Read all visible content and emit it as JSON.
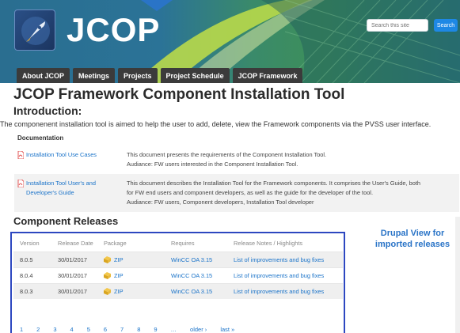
{
  "header": {
    "site_name": "JCOP",
    "search_placeholder": "Search this site",
    "search_button": "Search",
    "logo_icon": "rocket-icon"
  },
  "nav": {
    "tabs": [
      "About JCOP",
      "Meetings",
      "Projects",
      "Project Schedule",
      "JCOP Framework"
    ]
  },
  "page": {
    "title": "JCOP Framework Component Installation Tool",
    "intro_heading": "Introduction:",
    "intro_text": "The componenent installation tool is aimed to help the user to add, delete, view the Framework components via the PVSS user interface."
  },
  "documentation": {
    "heading": "Documentation",
    "rows": [
      {
        "link": "Installation Tool Use Cases",
        "desc_lines": [
          "This document presents the requirements of the Component Installation Tool.",
          "Audiance: FW users interested in the Component Installation Tool."
        ]
      },
      {
        "link": "Installation Tool User's and Developer's Guide",
        "desc_lines": [
          "This document describes the Installation Tool for the Framework components. It comprises the User's Guide, both",
          "for FW end users and component developers, as well as the guide for the developer of the tool.",
          "Audiance: FW users, Component developers, Installation Tool developer"
        ]
      }
    ]
  },
  "releases": {
    "heading": "Component Releases",
    "columns": {
      "version": "Version",
      "release_date": "Release Date",
      "package": "Package",
      "requires": "Requires",
      "notes": "Release Notes / Highlights"
    },
    "rows": [
      {
        "version": "8.0.5",
        "date": "30/01/2017",
        "package": "ZIP",
        "requires": "WinCC OA 3.15",
        "notes": "List of improvements and bug fixes"
      },
      {
        "version": "8.0.4",
        "date": "30/01/2017",
        "package": "ZIP",
        "requires": "WinCC OA 3.15",
        "notes": "List of improvements and bug fixes"
      },
      {
        "version": "8.0.3",
        "date": "30/01/2017",
        "package": "ZIP",
        "requires": "WinCC OA 3.15",
        "notes": "List of improvements and bug fixes"
      }
    ],
    "pager": [
      "1",
      "2",
      "3",
      "4",
      "5",
      "6",
      "7",
      "8",
      "9",
      "…",
      "older ›",
      "last »"
    ]
  },
  "annotation": {
    "callout": "Drupal View for imported releases",
    "color": "#2a74c7",
    "box_color": "#2d47c0"
  }
}
